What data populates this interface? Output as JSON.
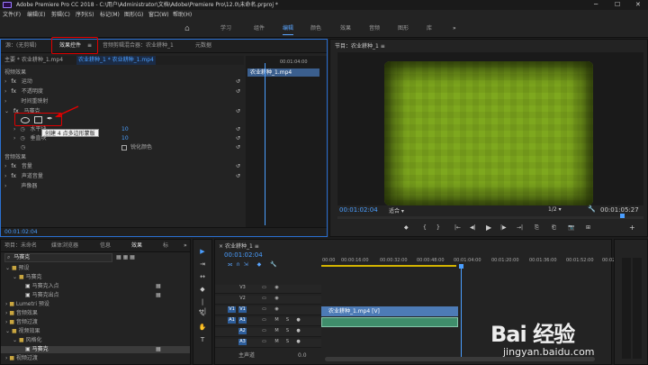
{
  "titlebar": {
    "text": "Adobe Premiere Pro CC 2018 - C:\\用户\\Administrator\\文档\\Adobe\\Premiere Pro\\12.0\\未命名.prproj *",
    "min": "─",
    "max": "☐",
    "close": "✕"
  },
  "menu": [
    "文件(F)",
    "编辑(E)",
    "剪辑(C)",
    "序列(S)",
    "标记(M)",
    "图形(G)",
    "窗口(W)",
    "帮助(H)"
  ],
  "workspaces": {
    "home": "⌂",
    "items": [
      "学习",
      "组件",
      "编辑",
      "颜色",
      "效果",
      "音频",
      "图形",
      "库"
    ],
    "more": "»"
  },
  "effect_controls": {
    "tabs": [
      "源：(无剪辑)",
      "效果控件",
      "音频剪辑混合器：农业耕种_1",
      "元数据"
    ],
    "tab_menu": "≡",
    "master_label": "主要 * 农业耕种_1.mp4",
    "sequence_label": "农业耕种_1 * 农业耕种_1.mp4",
    "timecode_top": "00:01:04:00",
    "clip_name": "农业耕种_1.mp4",
    "section_video": "视频效果",
    "rows": [
      {
        "label": "运动",
        "fx": "fx"
      },
      {
        "label": "不透明度",
        "fx": "fx"
      },
      {
        "label": "时间重映射",
        "fx": ""
      },
      {
        "label": "马赛克",
        "fx": "fx"
      }
    ],
    "tooltip": "创建 4 点多边形蒙版",
    "mosaic_params": [
      {
        "label": "水平块",
        "value": "10"
      },
      {
        "label": "垂直块",
        "value": "10"
      },
      {
        "label": "锐化颜色",
        "value": ""
      }
    ],
    "section_audio": "音频效果",
    "audio_rows": [
      {
        "label": "音量",
        "fx": "fx"
      },
      {
        "label": "声道音量",
        "fx": "fx"
      },
      {
        "label": "声像器",
        "fx": ""
      }
    ],
    "timecode_bottom": "00:01:02:04",
    "reset": "↺"
  },
  "program_monitor": {
    "title": "节目：农业耕种_1",
    "menu": "≡",
    "timecode": "00:01:02:04",
    "fit": "适合",
    "scale": "1/2",
    "duration": "00:01:05:27",
    "wrench": "🔧",
    "controls": [
      "◆",
      "{",
      "}",
      "|←",
      "◀|",
      "▶",
      "|▶",
      "→|",
      "⎘",
      "⎗",
      "📷",
      "⊞",
      "+"
    ]
  },
  "project_panel": {
    "tabs": [
      "项目：未命名",
      "媒体浏览器",
      "信息",
      "效果",
      "标"
    ],
    "more": "»",
    "search": "马赛克",
    "tree": [
      {
        "label": "预设",
        "indent": 1,
        "open": true
      },
      {
        "label": "马赛克",
        "indent": 2,
        "open": true
      },
      {
        "label": "马赛克入点",
        "indent": 3,
        "open": false
      },
      {
        "label": "马赛克出点",
        "indent": 3,
        "open": false
      },
      {
        "label": "Lumetri 预设",
        "indent": 1,
        "open": false
      },
      {
        "label": "音频效果",
        "indent": 1,
        "open": false
      },
      {
        "label": "音频过渡",
        "indent": 1,
        "open": false
      },
      {
        "label": "视频效果",
        "indent": 1,
        "open": true
      },
      {
        "label": "风格化",
        "indent": 2,
        "open": true
      },
      {
        "label": "马赛克",
        "indent": 3,
        "open": false
      },
      {
        "label": "视频过渡",
        "indent": 1,
        "open": false
      }
    ]
  },
  "tools": [
    "▶",
    "⇥",
    "↔",
    "◆",
    "|↔|",
    "✎",
    "✋",
    "T"
  ],
  "timeline": {
    "tab": "农业耕种_1",
    "menu": "≡",
    "timecode": "00:01:02:04",
    "ruler": [
      "00:00",
      "00:00:16:00",
      "00:00:32:00",
      "00:00:48:00",
      "00:01:04:00",
      "00:01:20:00",
      "00:01:36:00",
      "00:01:52:00",
      "00:02:08:00"
    ],
    "video_tracks": [
      "V3",
      "V2",
      "V1"
    ],
    "audio_tracks": [
      "A1",
      "A2",
      "A3"
    ],
    "clip_label": "农业耕种_1.mp4 [V]",
    "master": "主声道",
    "master_val": "0.0"
  },
  "watermark": {
    "brand": "Bai 经验",
    "url": "jingyan.baidu.com"
  }
}
